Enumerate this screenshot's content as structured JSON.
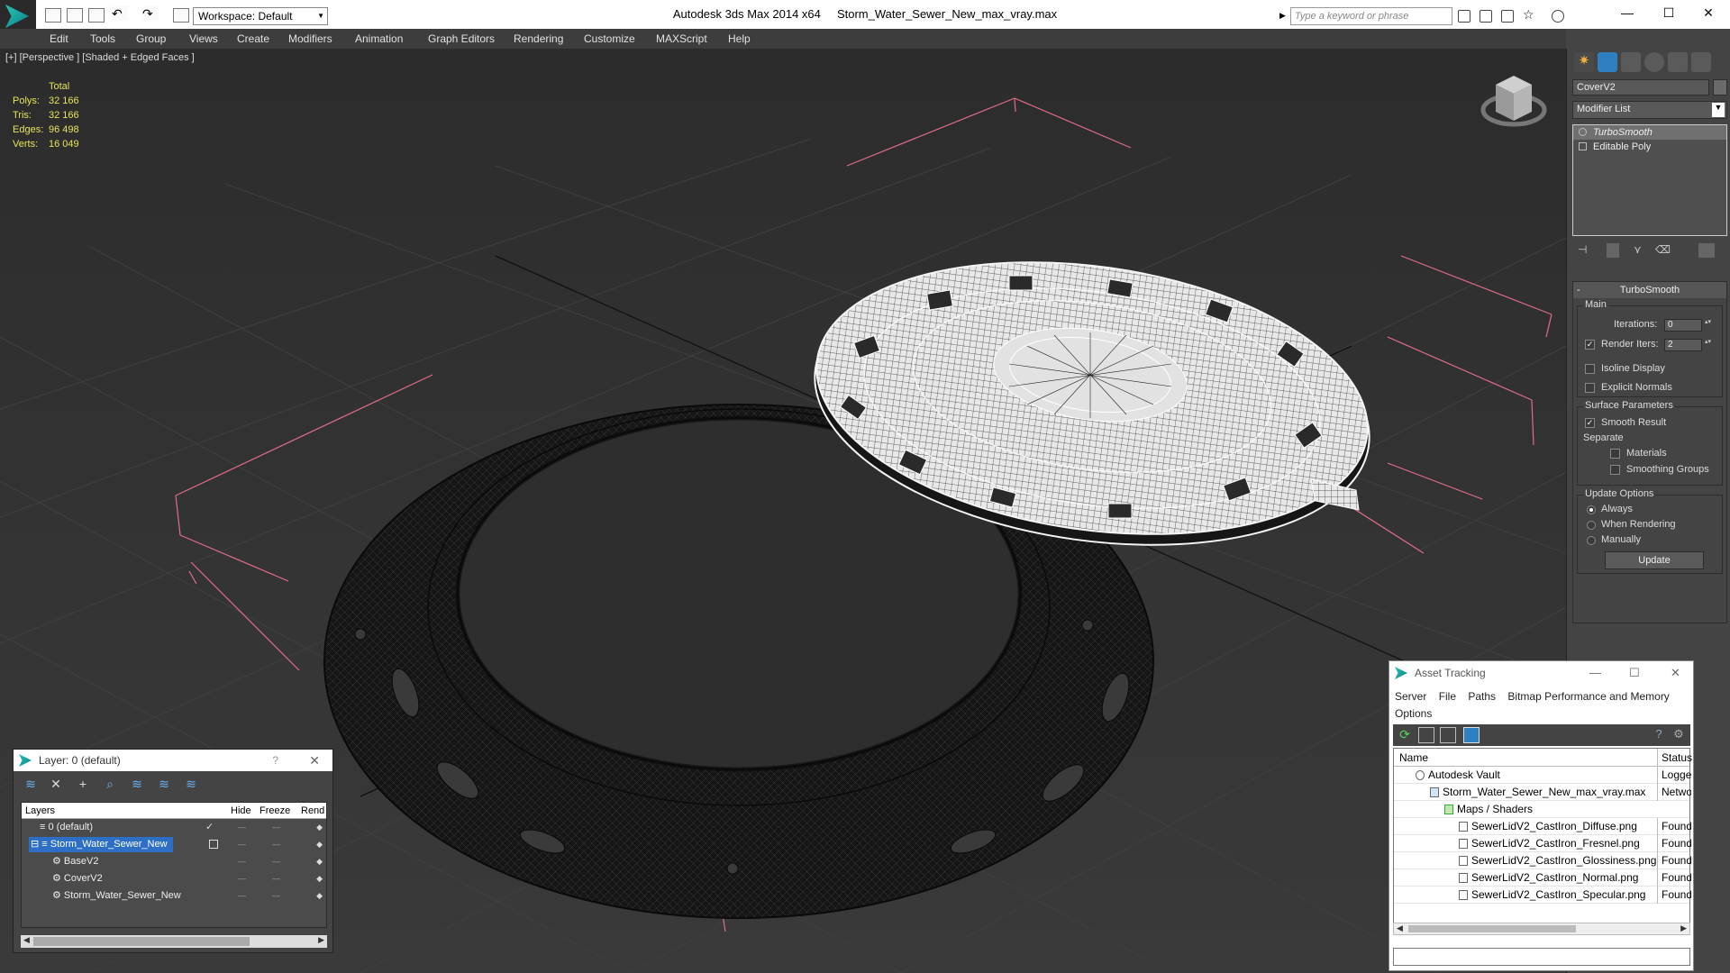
{
  "titlebar": {
    "workspace": "Workspace: Default",
    "app_title": "Autodesk 3ds Max  2014 x64",
    "file_title": "Storm_Water_Sewer_New_max_vray.max",
    "search_placeholder": "Type a keyword or phrase"
  },
  "menu": [
    "Edit",
    "Tools",
    "Group",
    "Views",
    "Create",
    "Modifiers",
    "Animation",
    "Graph Editors",
    "Rendering",
    "Customize",
    "MAXScript",
    "Help"
  ],
  "viewport": {
    "label": "[+] [Perspective ] [Shaded + Edged Faces ]",
    "stats": {
      "header": "Total",
      "polys_label": "Polys:",
      "polys": "32 166",
      "tris_label": "Tris:",
      "tris": "32 166",
      "edges_label": "Edges:",
      "edges": "96 498",
      "verts_label": "Verts:",
      "verts": "16 049"
    }
  },
  "command_panel": {
    "object_name": "CoverV2",
    "modifier_list": "Modifier List",
    "stack": [
      "TurboSmooth",
      "Editable Poly"
    ],
    "rollout_title": "TurboSmooth",
    "main_group": "Main",
    "iterations_label": "Iterations:",
    "iterations": "0",
    "render_iters_label": "Render Iters:",
    "render_iters": "2",
    "isoline": "Isoline Display",
    "explicit": "Explicit Normals",
    "surface_group": "Surface Parameters",
    "smooth_result": "Smooth Result",
    "separate": "Separate",
    "materials": "Materials",
    "smoothing_groups": "Smoothing Groups",
    "update_group": "Update Options",
    "always": "Always",
    "when_rendering": "When Rendering",
    "manually": "Manually",
    "update_btn": "Update"
  },
  "layer_dialog": {
    "title": "Layer: 0 (default)",
    "help": "?",
    "columns": {
      "layers": "Layers",
      "hide": "Hide",
      "freeze": "Freeze",
      "render": "Rend"
    },
    "rows": [
      {
        "name": "0 (default)"
      },
      {
        "name": "Storm_Water_Sewer_New"
      },
      {
        "name": "BaseV2"
      },
      {
        "name": "CoverV2"
      },
      {
        "name": "Storm_Water_Sewer_New"
      }
    ]
  },
  "asset_dialog": {
    "title": "Asset Tracking",
    "menu": [
      "Server",
      "File",
      "Paths",
      "Bitmap Performance and Memory"
    ],
    "menu2": "Options",
    "columns": {
      "name": "Name",
      "status": "Status"
    },
    "rows": [
      {
        "name": "Autodesk Vault",
        "status": "Logged"
      },
      {
        "name": "Storm_Water_Sewer_New_max_vray.max",
        "status": "Networ"
      },
      {
        "name": "Maps / Shaders",
        "status": ""
      },
      {
        "name": "SewerLidV2_CastIron_Diffuse.png",
        "status": "Found"
      },
      {
        "name": "SewerLidV2_CastIron_Fresnel.png",
        "status": "Found"
      },
      {
        "name": "SewerLidV2_CastIron_Glossiness.png",
        "status": "Found"
      },
      {
        "name": "SewerLidV2_CastIron_Normal.png",
        "status": "Found"
      },
      {
        "name": "SewerLidV2_CastIron_Specular.png",
        "status": "Found"
      }
    ]
  }
}
